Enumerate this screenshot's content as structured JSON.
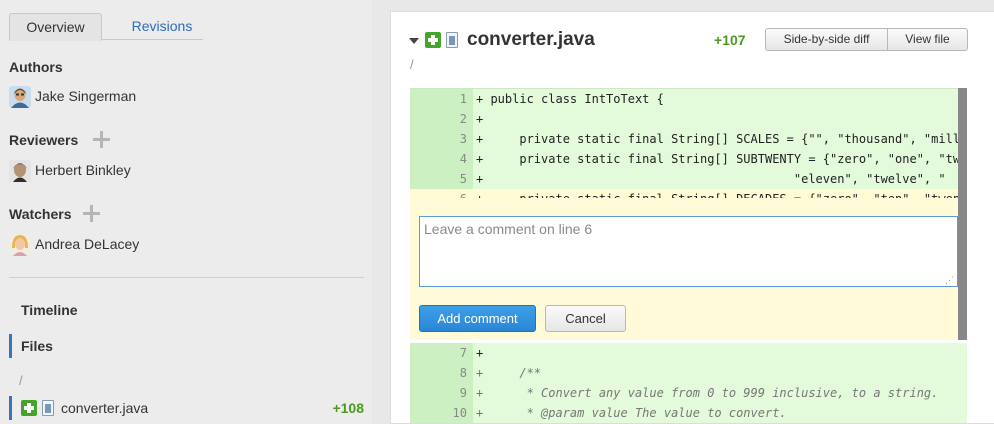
{
  "tabs": {
    "overview": "Overview",
    "revisions": "Revisions"
  },
  "authors": {
    "title": "Authors",
    "people": [
      {
        "name": "Jake Singerman"
      }
    ]
  },
  "reviewers": {
    "title": "Reviewers",
    "people": [
      {
        "name": "Herbert Binkley"
      }
    ]
  },
  "watchers": {
    "title": "Watchers",
    "people": [
      {
        "name": "Andrea DeLacey"
      }
    ]
  },
  "nav": {
    "timeline": "Timeline",
    "files": "Files"
  },
  "sidebar_files": {
    "path": "/",
    "items": [
      {
        "name": "converter.java",
        "count": "+108"
      }
    ]
  },
  "file": {
    "name": "converter.java",
    "count": "+107",
    "path": "/",
    "side_by_side_label": "Side-by-side diff",
    "view_file_label": "View file"
  },
  "diff": {
    "line_numbers": [
      "1",
      "2",
      "3",
      "4",
      "5",
      "6",
      "7",
      "8",
      "9",
      "10"
    ],
    "lines": [
      "+ public class IntToText {",
      "+",
      "+     private static final String[] SCALES = {\"\", \"thousand\", \"million\"",
      "+     private static final String[] SUBTWENTY = {\"zero\", \"one\", \"two\",",
      "+                                           \"eleven\", \"twelve\", \"",
      "+     private static final String[] DECADES = {\"zero\", \"ten\", \"twenty\"",
      "+",
      "+     /**",
      "+      * Convert any value from 0 to 999 inclusive, to a string.",
      "+      * @param value The value to convert."
    ]
  },
  "comment": {
    "placeholder": "Leave a comment on line 6",
    "add_label": "Add comment",
    "cancel_label": "Cancel"
  },
  "colors": {
    "added_count": "#4d9a21",
    "diff_added_bg": "#e3fbdb",
    "diff_gutter_bg": "#cdf0c3",
    "highlight_bg": "#fffbd4",
    "primary_button": "#2a86d4",
    "link": "#2a6ebd"
  },
  "icons": [
    "plus-icon",
    "add-file-icon",
    "document-icon",
    "caret-down-icon",
    "resize-grip-icon"
  ]
}
